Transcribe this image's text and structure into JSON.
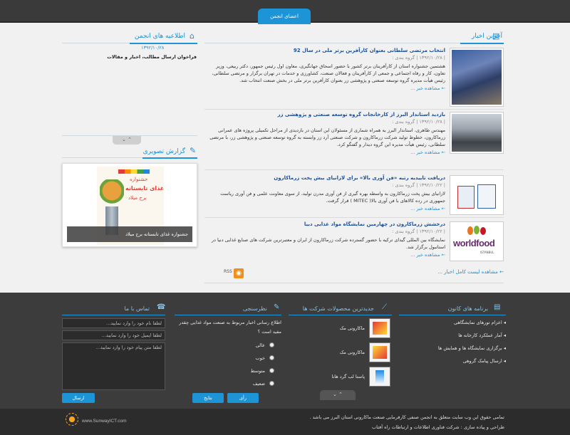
{
  "header": {
    "member_tab": "اعضای انجمن"
  },
  "news": {
    "title": "آخرین اخبار",
    "items": [
      {
        "title": "انتخاب مرتضی سلطانی بعنوان کارآفرین برتر ملی در سال 92",
        "meta": "| ۱۳۹۲/۱۰/۲۸ | گروه بندی :",
        "body": "هشتمین جشنواره استان از کارآفرینان برتر کشور با حضور اسحاق جهانگیری، معاون اول رئیس جمهور، دکتر ربیعی، وزیر تعاون، کار و رفاه اجتماعی و جمعی از کارآفرینان و فعالان صنعت، کشاورزی و خدمات در تهران برگزار و مرتضی سلطانی، رئیس هیأت مدیره گروه توسعه صنعتی و پژوهشی زر بعنوان کارآفرین برتر ملی در بخش صنعت انتخاب شد.",
        "more": "مشاهده خبر ..."
      },
      {
        "title": "بازدید استاندار البرز از کارخانجات گروه توسعه صنعتی و پژوهشی زر",
        "meta": "| ۱۳۹۲/۱۰/۲۸ | گروه بندی :",
        "body": "مهندس طاهری، استاندار البرز به همراه شماری از مسئولان این استان در بازدیدی از مراحل تکمیلی پروژه های عمرانی زرماکارون، خطوط تولید شرکت زرماکارون و شرکت صنعتی آرد زر وابسته به گروه توسعه صنعتی و پژوهشی زر، با مرتضی سلطانی، رئیس هیأت مدیره این گروه دیدار و گفتگو کرد.",
        "more": "مشاهده خبر ..."
      },
      {
        "title": "دریافت تاییدیه رتبه «فن آوری بالا» برای لازانیای بیش پخت زرماکارون",
        "meta": "| ۱۳۹۲/۱۰/۲۲ | گروه بندی :",
        "body": "لازانیای بیش پخت زرماکارون به واسطه بهره گیری از فن آوری مدرن تولید، از سوی معاونت علمی و فن آوری ریاست جمهوری در رده کالاهای با فن آوری بالا( MITEC ) قرار گرفت.",
        "more": "مشاهده خبر ..."
      },
      {
        "title": "درخشش زرماکارون در چهارمین نمایشگاه مواد غذایی دبیا",
        "meta": "| ۱۳۹۲/۱۰/۲۲ | گروه بندی :",
        "body": "نمایشگاه بین المللی گیدای ترکیه با حضور گسترده شرکت زرماکارون از ایران و معتبرترین شرکت های صنایع غذایی دنیا در استانبول برگزار شد.",
        "more": "مشاهده خبر ..."
      }
    ],
    "rss": "RSS",
    "all_news": "مشاهده لیست کامل اخبار ..."
  },
  "association": {
    "title": "اطلاعیه های انجمن",
    "date": "۱۳۹۲/۱۰/۲۸",
    "text": "فراخوان ارسال مطالب، اخبار و مقالات"
  },
  "gallery": {
    "title": "گزارش تصویری",
    "poster_line1": "جشنواره",
    "poster_line2": "غذای تابستانه",
    "poster_line3": "برج میلاد",
    "caption": "جشنواره غذای تابستانه برج میلاد"
  },
  "footer": {
    "programs": {
      "title": "برنامه های کانون",
      "items": [
        "اعزام تورهای نمایشگاهی",
        "آمار عملکرد کارخانه ها",
        "برگزاری نمایشگاه ها و همایش ها",
        "ارسال پیامک گروهی"
      ]
    },
    "products": {
      "title": "جدیدترین محصولات شرکت ها",
      "items": [
        "ماکارونی مک",
        "ماکارونی مک",
        "پاستا لب گرد هانا"
      ]
    },
    "poll": {
      "title": "نظرسنجی",
      "question": "اطلاع رسانی اخبار مربوط به صنعت مواد غذایی چقدر مفید است ؟",
      "options": [
        "عالی",
        "خوب",
        "متوسط",
        "ضعیف"
      ],
      "vote": "رأی",
      "results": "نتایج"
    },
    "contact": {
      "title": "تماس با ما",
      "name_placeholder": "لطفا نام خود را وارد نمایید...",
      "email_placeholder": "لطفا ایمیل خود را وارد نمایید...",
      "message_placeholder": "لطفا متن پیام خود را وارد نمایید...",
      "send": "ارسال"
    },
    "copyright_line1": "تمامی حقوق این وب سایت متعلق به انجمن صنفی کارفرمایی صنعت ماکارونی استان البرز می باشد .",
    "copyright_line2": "طراحی و پیاده سازی : شرکت فناوری اطلاعات و ارتباطات راه آفتاب",
    "logo_text": "www.SunwayICT.com"
  }
}
